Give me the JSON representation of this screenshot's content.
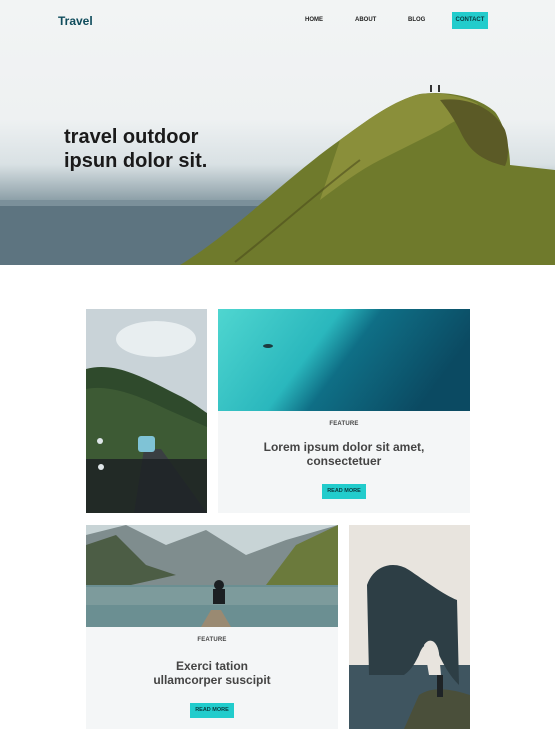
{
  "header": {
    "logo": "Travel",
    "nav": {
      "home": "HOME",
      "about": "ABOUT",
      "blog": "BLOG",
      "contact": "CONTACT"
    }
  },
  "hero": {
    "headline_line1": "travel outdoor",
    "headline_line2": "ipsun dolor sit."
  },
  "features": [
    {
      "label": "FEATURE",
      "title_line1": "Lorem ipsum dolor sit amet,",
      "title_line2": "consectetuer",
      "button": "READ MORE"
    },
    {
      "label": "FEATURE",
      "title_line1": "Exerci tation",
      "title_line2": "ullamcorper suscipit",
      "button": "READ MORE"
    }
  ],
  "colors": {
    "accent": "#22cccc",
    "logo": "#0f4c5c",
    "panel": "#f4f6f7"
  }
}
